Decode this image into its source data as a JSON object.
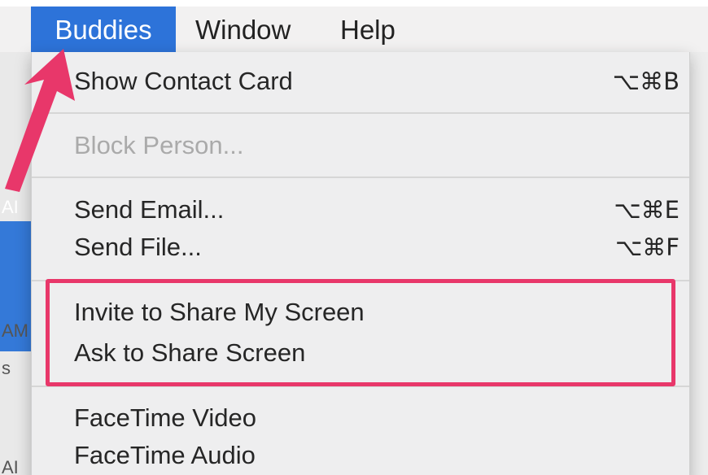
{
  "menubar": {
    "items": [
      {
        "label": "Buddies",
        "active": true
      },
      {
        "label": "Window"
      },
      {
        "label": "Help"
      }
    ]
  },
  "menu": {
    "sections": [
      [
        {
          "label": "Show Contact Card",
          "shortcut": "⌥⌘B"
        }
      ],
      [
        {
          "label": "Block Person...",
          "disabled": true
        }
      ],
      [
        {
          "label": "Send Email...",
          "shortcut": "⌥⌘E"
        },
        {
          "label": "Send File...",
          "shortcut": "⌥⌘F"
        }
      ],
      [
        {
          "label": "Invite to Share My Screen"
        },
        {
          "label": "Ask to Share Screen"
        }
      ],
      [
        {
          "label": "FaceTime Video"
        },
        {
          "label": "FaceTime Audio"
        }
      ]
    ]
  },
  "background_window": {
    "fragments": [
      "AI",
      "AM",
      "s",
      "AI"
    ]
  },
  "colors": {
    "menu_highlight": "#2d73d9",
    "annotation": "#e8376a",
    "menu_background": "#eeeeef"
  }
}
